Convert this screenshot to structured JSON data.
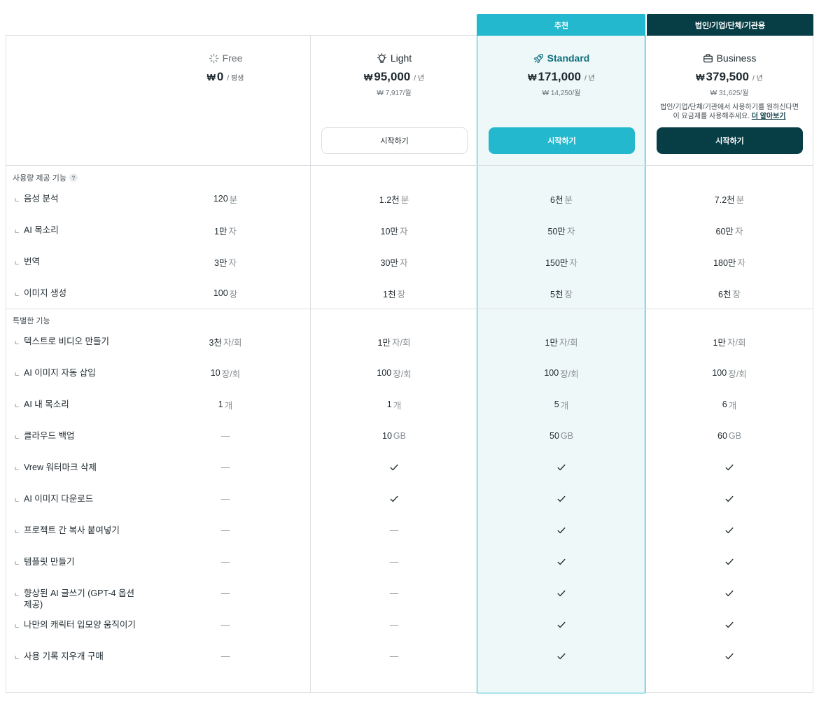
{
  "tags": {
    "recommended": "추천",
    "business": "법인/기업/단체/기관용"
  },
  "plans": [
    {
      "name": "Free",
      "icon": "sparkle-icon",
      "currency": "₩",
      "price": "0",
      "period": "/ 평생",
      "monthly": "",
      "button": "",
      "note": ""
    },
    {
      "name": "Light",
      "icon": "lightbulb-icon",
      "currency": "₩",
      "price": "95,000",
      "period": "/ 년",
      "monthly": "₩ 7,917/월",
      "button": "시작하기",
      "note": ""
    },
    {
      "name": "Standard",
      "icon": "rocket-icon",
      "currency": "₩",
      "price": "171,000",
      "period": "/ 년",
      "monthly": "₩ 14,250/월",
      "button": "시작하기",
      "note": ""
    },
    {
      "name": "Business",
      "icon": "briefcase-icon",
      "currency": "₩",
      "price": "379,500",
      "period": "/ 년",
      "monthly": "₩ 31,625/월",
      "button": "시작하기",
      "note_line1": "법인/기업/단체/기관에서 사용하기를 원하신다면",
      "note_line2": "이 요금제를 사용해주세요.",
      "note_link": "더 알아보기"
    }
  ],
  "sections": [
    {
      "title": "사용량 제공 기능",
      "has_help": true,
      "rows": [
        {
          "label": "음성 분석",
          "cells": [
            {
              "v": "120",
              "u": "분"
            },
            {
              "v": "1.2천",
              "u": "분"
            },
            {
              "v": "6천",
              "u": "분"
            },
            {
              "v": "7.2천",
              "u": "분"
            }
          ]
        },
        {
          "label": "AI 목소리",
          "cells": [
            {
              "v": "1만",
              "u": "자"
            },
            {
              "v": "10만",
              "u": "자"
            },
            {
              "v": "50만",
              "u": "자"
            },
            {
              "v": "60만",
              "u": "자"
            }
          ]
        },
        {
          "label": "번역",
          "cells": [
            {
              "v": "3만",
              "u": "자"
            },
            {
              "v": "30만",
              "u": "자"
            },
            {
              "v": "150만",
              "u": "자"
            },
            {
              "v": "180만",
              "u": "자"
            }
          ]
        },
        {
          "label": "이미지 생성",
          "cells": [
            {
              "v": "100",
              "u": "장"
            },
            {
              "v": "1천",
              "u": "장"
            },
            {
              "v": "5천",
              "u": "장"
            },
            {
              "v": "6천",
              "u": "장"
            }
          ]
        }
      ]
    },
    {
      "title": "특별한 기능",
      "has_help": false,
      "rows": [
        {
          "label": "텍스트로 비디오 만들기",
          "cells": [
            {
              "v": "3천",
              "u": "자/회"
            },
            {
              "v": "1만",
              "u": "자/회"
            },
            {
              "v": "1만",
              "u": "자/회"
            },
            {
              "v": "1만",
              "u": "자/회"
            }
          ]
        },
        {
          "label": "AI 이미지 자동 삽입",
          "cells": [
            {
              "v": "10",
              "u": "장/회"
            },
            {
              "v": "100",
              "u": "장/회"
            },
            {
              "v": "100",
              "u": "장/회"
            },
            {
              "v": "100",
              "u": "장/회"
            }
          ]
        },
        {
          "label": "AI 내 목소리",
          "cells": [
            {
              "v": "1",
              "u": "개"
            },
            {
              "v": "1",
              "u": "개"
            },
            {
              "v": "5",
              "u": "개"
            },
            {
              "v": "6",
              "u": "개"
            }
          ]
        },
        {
          "label": "클라우드 백업",
          "cells": [
            {
              "v": "—",
              "u": ""
            },
            {
              "v": "10",
              "u": "GB"
            },
            {
              "v": "50",
              "u": "GB"
            },
            {
              "v": "60",
              "u": "GB"
            }
          ]
        },
        {
          "label": "Vrew 워터마크 삭제",
          "cells": [
            {
              "v": "—"
            },
            {
              "v": "check"
            },
            {
              "v": "check"
            },
            {
              "v": "check"
            }
          ]
        },
        {
          "label": "AI 이미지 다운로드",
          "cells": [
            {
              "v": "—"
            },
            {
              "v": "check"
            },
            {
              "v": "check"
            },
            {
              "v": "check"
            }
          ]
        },
        {
          "label": "프로젝트 간 복사 붙여넣기",
          "cells": [
            {
              "v": "—"
            },
            {
              "v": "—"
            },
            {
              "v": "check"
            },
            {
              "v": "check"
            }
          ]
        },
        {
          "label": "템플릿 만들기",
          "cells": [
            {
              "v": "—"
            },
            {
              "v": "—"
            },
            {
              "v": "check"
            },
            {
              "v": "check"
            }
          ]
        },
        {
          "label": "향상된 AI 글쓰기 (GPT-4 옵션 제공)",
          "cells": [
            {
              "v": "—"
            },
            {
              "v": "—"
            },
            {
              "v": "check"
            },
            {
              "v": "check"
            }
          ]
        },
        {
          "label": "나만의 캐릭터 입모양 움직이기",
          "cells": [
            {
              "v": "—"
            },
            {
              "v": "—"
            },
            {
              "v": "check"
            },
            {
              "v": "check"
            }
          ]
        },
        {
          "label": "사용 기록 지우개 구매",
          "cells": [
            {
              "v": "—"
            },
            {
              "v": "—"
            },
            {
              "v": "check"
            },
            {
              "v": "check"
            }
          ]
        }
      ]
    }
  ],
  "colors": {
    "accent": "#23b8ce",
    "dark": "#073d45",
    "border": "#dcdfe2",
    "highlight_bg": "#eff8f9"
  }
}
